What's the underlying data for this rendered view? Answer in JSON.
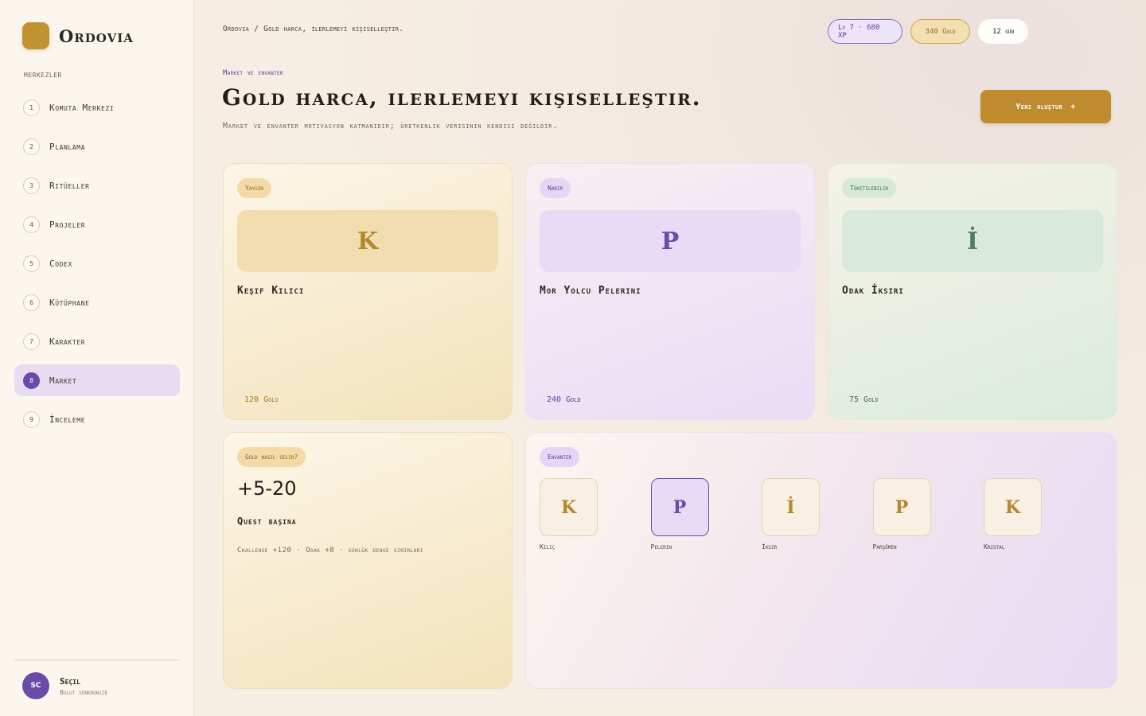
{
  "app": {
    "name": "Ordovia"
  },
  "sidebar": {
    "section_label": "Merkezler",
    "items": [
      {
        "num": "1",
        "label": "Komuta Merkezi",
        "active": false
      },
      {
        "num": "2",
        "label": "Planlama",
        "active": false
      },
      {
        "num": "3",
        "label": "Ritüeller",
        "active": false
      },
      {
        "num": "4",
        "label": "Projeler",
        "active": false
      },
      {
        "num": "5",
        "label": "Codex",
        "active": false
      },
      {
        "num": "6",
        "label": "Kütüphane",
        "active": false
      },
      {
        "num": "7",
        "label": "Karakter",
        "active": false
      },
      {
        "num": "8",
        "label": "Market",
        "active": true
      },
      {
        "num": "9",
        "label": "İnceleme",
        "active": false
      }
    ],
    "user": {
      "initials": "SC",
      "name": "Seçil",
      "status": "Bulut senkronize"
    }
  },
  "header": {
    "breadcrumb": "Ordovia / Gold harca, ilerlemeyi kişiselleştir.",
    "level_pill": "Lv 7 · 680 XP",
    "gold_pill": "340 Gold",
    "streak_pill": "12 gün"
  },
  "page": {
    "eyebrow": "Market ve envanter",
    "title": "Gold harca, ilerlemeyi kişiselleştir.",
    "subtitle": "Market ve envanter motivasyon katmanıdır; üretkenlik verisinin kendisi değildir.",
    "create_button": "Yeni oluştur",
    "create_button_icon": "+"
  },
  "items": [
    {
      "rarity": "Yaygın",
      "glyph": "K",
      "name": "Keşif Kılıcı",
      "price": "120 Gold",
      "color": "#b8862e"
    },
    {
      "rarity": "Nadir",
      "glyph": "P",
      "name": "Mor Yolcu Pelerini",
      "price": "240 Gold",
      "color": "#6b4ba6"
    },
    {
      "rarity": "Tüketilebilir",
      "glyph": "İ",
      "name": "Odak İksiri",
      "price": "75 Gold",
      "color": "#4f7c62"
    }
  ],
  "gold_info": {
    "badge": "Gold nasıl gelir?",
    "amount": "+5-20",
    "per": "Quest başına",
    "detail": "Challenge +120 · Odak +8 · günlük denge sınırları"
  },
  "inventory": {
    "badge": "Envanter",
    "slots": [
      {
        "glyph": "K",
        "label": "Kılıç",
        "selected": false
      },
      {
        "glyph": "P",
        "label": "Pelerin",
        "selected": true
      },
      {
        "glyph": "İ",
        "label": "İksir",
        "selected": false
      },
      {
        "glyph": "P",
        "label": "Parşömen",
        "selected": false
      },
      {
        "glyph": "K",
        "label": "Kristal",
        "selected": false
      }
    ]
  },
  "colors": {
    "accent_gold": "#bf8b2f",
    "accent_purple": "#6b4ba6",
    "accent_green": "#4f7c62"
  }
}
